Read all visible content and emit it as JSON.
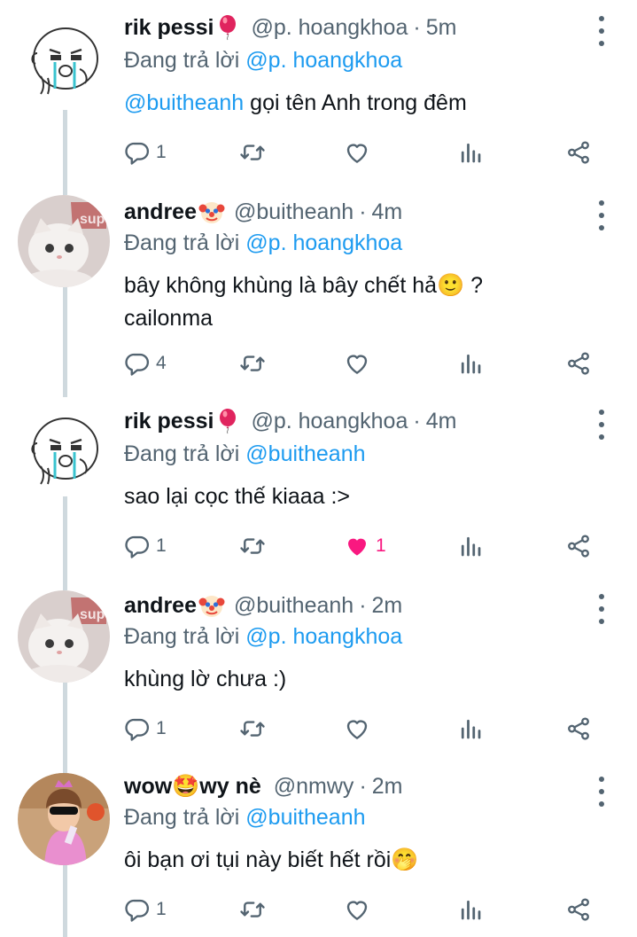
{
  "reply_prefix": "Đang trả lời",
  "colors": {
    "accent": "#1d9bf0",
    "like": "#f91880",
    "muted": "#536471",
    "thread_line": "#cfd9de"
  },
  "tweets": [
    {
      "name": "rik pessi",
      "name_emoji": "balloon-emoji",
      "handle": "@p. hoangkhoa",
      "separator": "·",
      "time": "5m",
      "replying_to": "@p. hoangkhoa",
      "text_mention": "@buitheanh",
      "text": " gọi tên Anh trong đêm",
      "replies": "1",
      "retweets": "",
      "likes": "",
      "liked": false
    },
    {
      "name": "andree",
      "name_emoji": "clown-emoji",
      "handle": "@buitheanh",
      "separator": "·",
      "time": "4m",
      "replying_to": "@p. hoangkhoa",
      "text_mention": "",
      "text": "bây không khùng là bây chết hả🙂 ? cailonma",
      "replies": "4",
      "retweets": "",
      "likes": "",
      "liked": false
    },
    {
      "name": "rik pessi",
      "name_emoji": "balloon-emoji",
      "handle": "@p. hoangkhoa",
      "separator": "·",
      "time": "4m",
      "replying_to": "@buitheanh",
      "text_mention": "",
      "text": "sao lại cọc thế kiaaa :>",
      "replies": "1",
      "retweets": "",
      "likes": "1",
      "liked": true
    },
    {
      "name": "andree",
      "name_emoji": "clown-emoji",
      "handle": "@buitheanh",
      "separator": "·",
      "time": "2m",
      "replying_to": "@p. hoangkhoa",
      "text_mention": "",
      "text": "khùng lờ chưa :)",
      "replies": "1",
      "retweets": "",
      "likes": "",
      "liked": false
    },
    {
      "name": "wow🤩wy nè",
      "name_emoji": "",
      "handle": "@nmwy",
      "separator": "·",
      "time": "2m",
      "replying_to": "@buitheanh",
      "text_mention": "",
      "text": "ôi bạn ơi tụi này biết hết rồi🤭",
      "replies": "1",
      "retweets": "",
      "likes": "",
      "liked": false
    }
  ]
}
